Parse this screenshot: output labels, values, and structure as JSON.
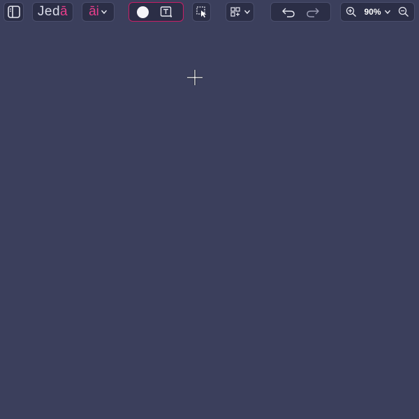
{
  "logo": {
    "prefix": "Jed",
    "suffix": "ā"
  },
  "ai": {
    "label": "āi"
  },
  "zoom": {
    "value": "90%"
  },
  "icons": {
    "sidebar": "sidebar-toggle-icon",
    "ai_dropdown": "chevron-down-icon",
    "mode_circle": "circle-mode-icon",
    "text_tool": "text-box-icon",
    "select_tool": "marquee-select-icon",
    "layout": "grid-add-icon",
    "undo": "undo-icon",
    "redo": "redo-icon",
    "zoom_in": "zoom-in-icon",
    "zoom_out": "zoom-out-icon",
    "cursor": "crosshair-cursor-icon"
  },
  "colors": {
    "canvas": "#3b3f5c",
    "toolbar_bg": "#2b2e46",
    "accent": "#e63e8b",
    "mode_border": "#c81e66"
  }
}
